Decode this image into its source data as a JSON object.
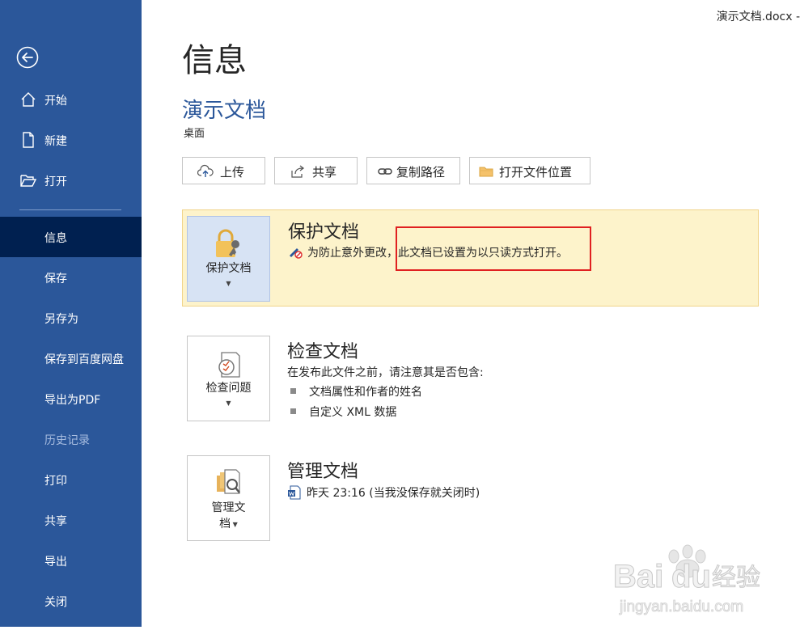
{
  "window": {
    "doc_title": "演示文档.docx -"
  },
  "sidebar": {
    "items": [
      {
        "label": "开始",
        "icon": "home-icon"
      },
      {
        "label": "新建",
        "icon": "new-document-icon"
      },
      {
        "label": "打开",
        "icon": "folder-open-icon"
      },
      {
        "label": "信息",
        "active": true
      },
      {
        "label": "保存"
      },
      {
        "label": "另存为"
      },
      {
        "label": "保存到百度网盘"
      },
      {
        "label": "导出为PDF"
      },
      {
        "label": "历史记录",
        "disabled": true
      },
      {
        "label": "打印"
      },
      {
        "label": "共享"
      },
      {
        "label": "导出"
      },
      {
        "label": "关闭"
      }
    ]
  },
  "main": {
    "title": "信息",
    "doc_name": "演示文档",
    "location": "桌面",
    "actions": [
      {
        "label": "上传",
        "icon": "cloud-upload-icon"
      },
      {
        "label": "共享",
        "icon": "share-icon"
      },
      {
        "label": "复制路径",
        "icon": "link-icon"
      },
      {
        "label": "打开文件位置",
        "icon": "folder-icon"
      }
    ],
    "protect": {
      "tile_label": "保护文档",
      "title": "保护文档",
      "desc": "为防止意外更改，此文档已设置为以只读方式打开。"
    },
    "inspect": {
      "tile_label": "检查问题",
      "title": "检查文档",
      "desc": "在发布此文件之前，请注意其是否包含:",
      "bullets": [
        "文档属性和作者的姓名",
        "自定义 XML 数据"
      ]
    },
    "manage": {
      "tile_label_1": "管理文",
      "tile_label_2": "档",
      "title": "管理文档",
      "version": "昨天 23:16 (当我没保存就关闭时)"
    }
  },
  "watermark": {
    "brand": "Bai du 经验",
    "url": "jingyan.baidu.com"
  },
  "colors": {
    "sidebar": "#2b579a",
    "sidebar_active": "#002050",
    "protect_bg": "#fdf3cb",
    "highlight": "#e02020"
  }
}
